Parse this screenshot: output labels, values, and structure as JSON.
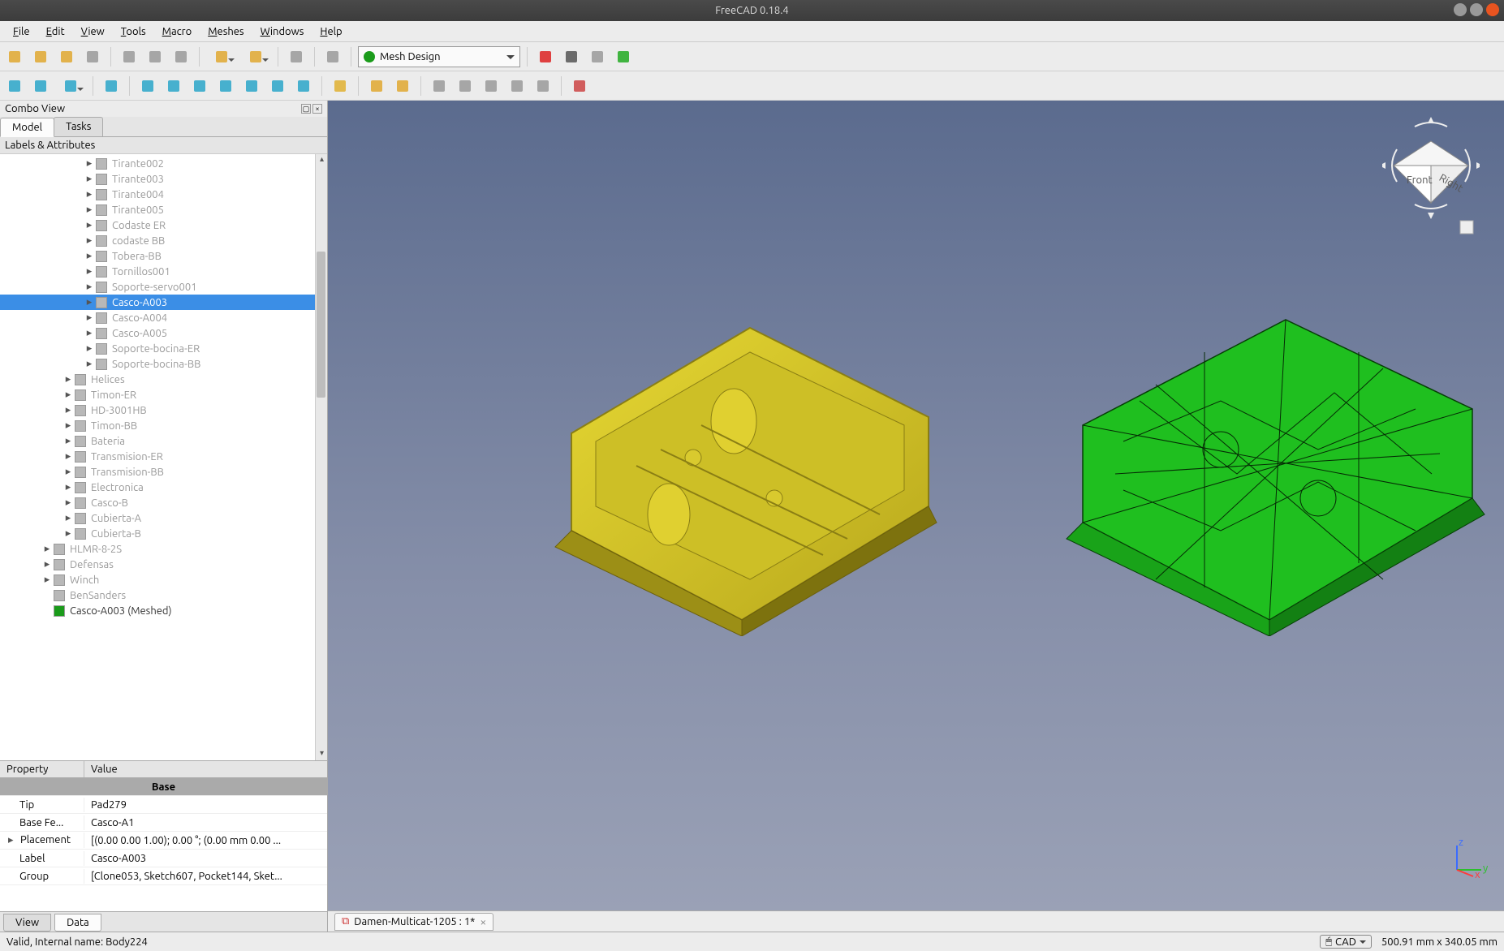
{
  "title": "FreeCAD 0.18.4",
  "menus": [
    "File",
    "Edit",
    "View",
    "Tools",
    "Macro",
    "Meshes",
    "Windows",
    "Help"
  ],
  "workbench_selected": "Mesh Design",
  "combo_view_title": "Combo View",
  "combo_tabs": [
    "Model",
    "Tasks"
  ],
  "tree_header": "Labels & Attributes",
  "tree": [
    {
      "indent": 2,
      "label": "Tirante002",
      "dim": true,
      "arrow": true
    },
    {
      "indent": 2,
      "label": "Tirante003",
      "dim": true,
      "arrow": true
    },
    {
      "indent": 2,
      "label": "Tirante004",
      "dim": true,
      "arrow": true
    },
    {
      "indent": 2,
      "label": "Tirante005",
      "dim": true,
      "arrow": true
    },
    {
      "indent": 2,
      "label": "Codaste ER",
      "dim": true,
      "arrow": true
    },
    {
      "indent": 2,
      "label": "codaste BB",
      "dim": true,
      "arrow": true
    },
    {
      "indent": 2,
      "label": "Tobera-BB",
      "dim": true,
      "arrow": true
    },
    {
      "indent": 2,
      "label": "Tornillos001",
      "dim": true,
      "arrow": true
    },
    {
      "indent": 2,
      "label": "Soporte-servo001",
      "dim": true,
      "arrow": true
    },
    {
      "indent": 2,
      "label": "Casco-A003",
      "dim": true,
      "arrow": true,
      "selected": true
    },
    {
      "indent": 2,
      "label": "Casco-A004",
      "dim": true,
      "arrow": true
    },
    {
      "indent": 2,
      "label": "Casco-A005",
      "dim": true,
      "arrow": true
    },
    {
      "indent": 2,
      "label": "Soporte-bocina-ER",
      "dim": true,
      "arrow": true
    },
    {
      "indent": 2,
      "label": "Soporte-bocina-BB",
      "dim": true,
      "arrow": true
    },
    {
      "indent": 1,
      "label": "Helices",
      "dim": true,
      "arrow": true
    },
    {
      "indent": 1,
      "label": "Timon-ER",
      "dim": true,
      "arrow": true
    },
    {
      "indent": 1,
      "label": "HD-3001HB",
      "dim": true,
      "arrow": true
    },
    {
      "indent": 1,
      "label": "Timon-BB",
      "dim": true,
      "arrow": true
    },
    {
      "indent": 1,
      "label": "Bateria",
      "dim": true,
      "arrow": true
    },
    {
      "indent": 1,
      "label": "Transmision-ER",
      "dim": true,
      "arrow": true
    },
    {
      "indent": 1,
      "label": "Transmision-BB",
      "dim": true,
      "arrow": true
    },
    {
      "indent": 1,
      "label": "Electronica",
      "dim": true,
      "arrow": true
    },
    {
      "indent": 1,
      "label": "Casco-B",
      "dim": true,
      "arrow": true
    },
    {
      "indent": 1,
      "label": "Cubierta-A",
      "dim": true,
      "arrow": true
    },
    {
      "indent": 1,
      "label": "Cubierta-B",
      "dim": true,
      "arrow": true
    },
    {
      "indent": 0,
      "label": "HLMR-8-2S",
      "dim": true,
      "arrow": true
    },
    {
      "indent": 0,
      "label": "Defensas",
      "dim": true,
      "arrow": true
    },
    {
      "indent": 0,
      "label": "Winch",
      "dim": true,
      "arrow": true
    },
    {
      "indent": 0,
      "label": "BenSanders",
      "dim": true,
      "arrow": false
    },
    {
      "indent": 0,
      "label": "Casco-A003 (Meshed)",
      "dim": false,
      "arrow": false,
      "meshed": true
    }
  ],
  "prop_headers": [
    "Property",
    "Value"
  ],
  "prop_group": "Base",
  "props": [
    {
      "k": "Tip",
      "v": "Pad279"
    },
    {
      "k": "Base Fe...",
      "v": "Casco-A1"
    },
    {
      "k": "Placement",
      "v": "[(0.00 0.00 1.00); 0.00 °; (0.00 mm  0.00 ...",
      "arrow": true
    },
    {
      "k": "Label",
      "v": "Casco-A003"
    },
    {
      "k": "Group",
      "v": "[Clone053, Sketch607, Pocket144, Sket..."
    }
  ],
  "bottom_tabs": [
    "View",
    "Data"
  ],
  "bottom_active": "Data",
  "doc_tab": "Damen-Multicat-1205 : 1*",
  "status_left": "Valid, Internal name: Body224",
  "status_cad": "CAD",
  "status_dim": "500.91 mm x 340.05 mm",
  "toolbar_icons_row1": [
    "new-file-icon",
    "open-file-icon",
    "save-icon",
    "print-icon",
    "|",
    "cut-icon",
    "copy-icon",
    "paste-icon",
    "|",
    "undo-icon",
    "redo-icon",
    "|",
    "refresh-icon",
    "|",
    "whats-this-icon",
    "|",
    "WB",
    "|",
    "record-macro-icon",
    "stop-macro-icon",
    "edit-macro-icon",
    "run-macro-icon"
  ],
  "toolbar_icons_row2": [
    "fit-all-icon",
    "fit-selection-icon",
    "draw-style-icon",
    "|",
    "bbox-icon",
    "|",
    "iso-view-icon",
    "front-view-icon",
    "top-view-icon",
    "right-view-icon",
    "rear-view-icon",
    "bottom-view-icon",
    "left-view-icon",
    "|",
    "measure-icon",
    "|",
    "create-mesh-icon",
    "display-mode-icon",
    "|",
    "import-mesh-icon",
    "export-mesh-icon",
    "mesh-from-shape-icon",
    "harmonize-icon",
    "analyze-icon",
    "|",
    "part-icon"
  ]
}
